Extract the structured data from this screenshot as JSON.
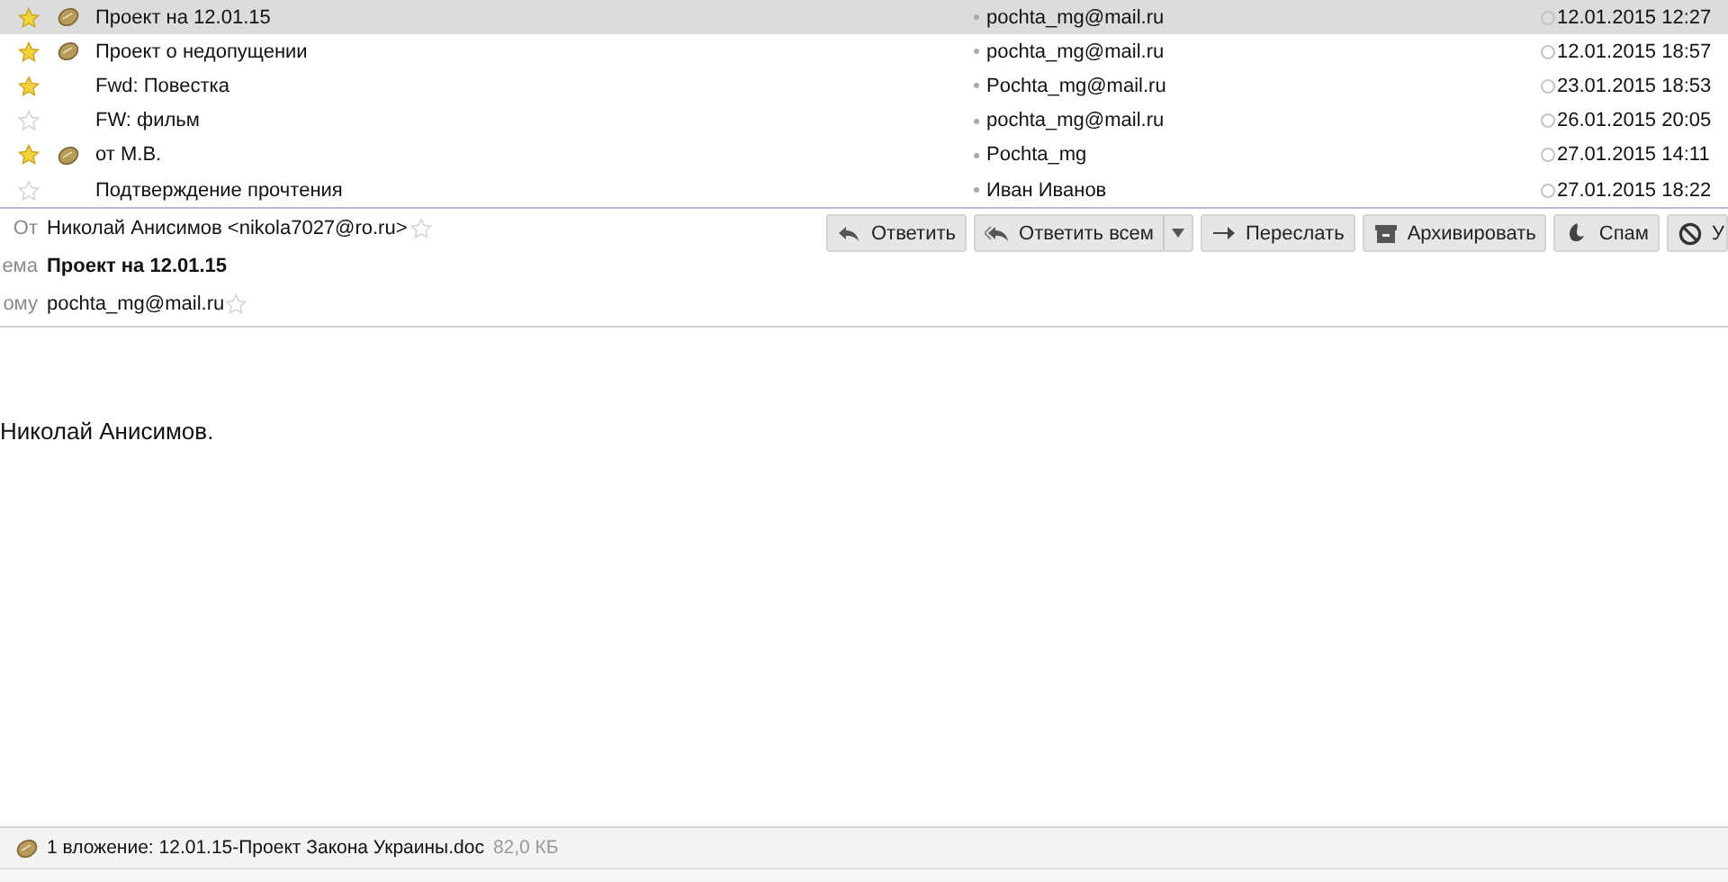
{
  "messages": [
    {
      "starred": true,
      "attachment": true,
      "selected": true,
      "subject": "Проект на 12.01.15",
      "sender": "pochta_mg@mail.ru",
      "date": "12.01.2015 12:27"
    },
    {
      "starred": true,
      "attachment": true,
      "selected": false,
      "subject": "Проект о недопущении",
      "sender": "pochta_mg@mail.ru",
      "date": "12.01.2015 18:57"
    },
    {
      "starred": true,
      "attachment": false,
      "selected": false,
      "subject": "Fwd: Повестка",
      "sender": "Pochta_mg@mail.ru",
      "date": "23.01.2015 18:53"
    },
    {
      "starred": false,
      "attachment": false,
      "selected": false,
      "subject": "FW: фильм",
      "sender": "pochta_mg@mail.ru",
      "date": "26.01.2015 20:05"
    },
    {
      "starred": true,
      "attachment": true,
      "selected": false,
      "subject": "от М.В.",
      "sender": "Pochta_mg",
      "date": "27.01.2015 14:11"
    },
    {
      "starred": false,
      "attachment": false,
      "selected": false,
      "subject": "Подтверждение прочтения",
      "sender": "Иван Иванов",
      "date": "27.01.2015 18:22"
    }
  ],
  "header": {
    "from_label": "От",
    "from": "Николай Анисимов <nikola7027@ro.ru>",
    "subject_label": "ема",
    "subject": "Проект на 12.01.15",
    "to_label": "ому",
    "to": "pochta_mg@mail.ru"
  },
  "toolbar": [
    {
      "kind": "reply",
      "label": "Ответить"
    },
    {
      "kind": "reply-all",
      "label": "Ответить всем"
    },
    {
      "kind": "forward",
      "label": "Переслать"
    },
    {
      "kind": "archive",
      "label": "Архивировать"
    },
    {
      "kind": "spam",
      "label": "Спам"
    },
    {
      "kind": "delete",
      "label": "У"
    }
  ],
  "body": "Николай Анисимов.",
  "attachment_bar": {
    "summary": "1 вложение: 12.01.15-Проект Закона Украины.doc",
    "size": "82,0 КБ"
  }
}
